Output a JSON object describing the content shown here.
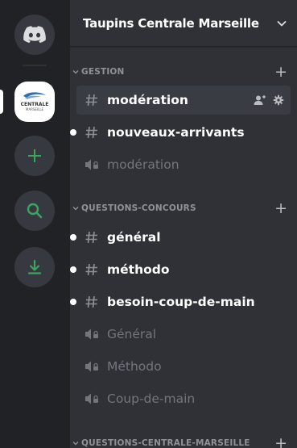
{
  "server": {
    "name": "Taupins Centrale Marseille",
    "logo_text_line1": "CENTRALE",
    "logo_text_line2": "MARSEILLE"
  },
  "categories": [
    {
      "label": "GESTION",
      "channels": [
        {
          "label": "modération",
          "type": "text",
          "active": true,
          "unread": false
        },
        {
          "label": "nouveaux-arrivants",
          "type": "text",
          "active": false,
          "unread": true
        },
        {
          "label": "modération",
          "type": "voice",
          "active": false,
          "unread": false
        }
      ]
    },
    {
      "label": "QUESTIONS-CONCOURS",
      "channels": [
        {
          "label": "général",
          "type": "text",
          "active": false,
          "unread": true
        },
        {
          "label": "méthodo",
          "type": "text",
          "active": false,
          "unread": true
        },
        {
          "label": "besoin-coup-de-main",
          "type": "text",
          "active": false,
          "unread": true
        },
        {
          "label": "Général",
          "type": "voice",
          "active": false,
          "unread": false
        },
        {
          "label": "Méthodo",
          "type": "voice",
          "active": false,
          "unread": false
        },
        {
          "label": "Coup-de-main",
          "type": "voice",
          "active": false,
          "unread": false
        }
      ]
    },
    {
      "label": "QUESTIONS-CENTRALE-MARSEILLE",
      "channels": []
    }
  ],
  "colors": {
    "accent_green": "#3ba55d",
    "rail_bg": "#202225",
    "sidebar_bg": "#2f3136",
    "active_bg": "#393c43"
  }
}
